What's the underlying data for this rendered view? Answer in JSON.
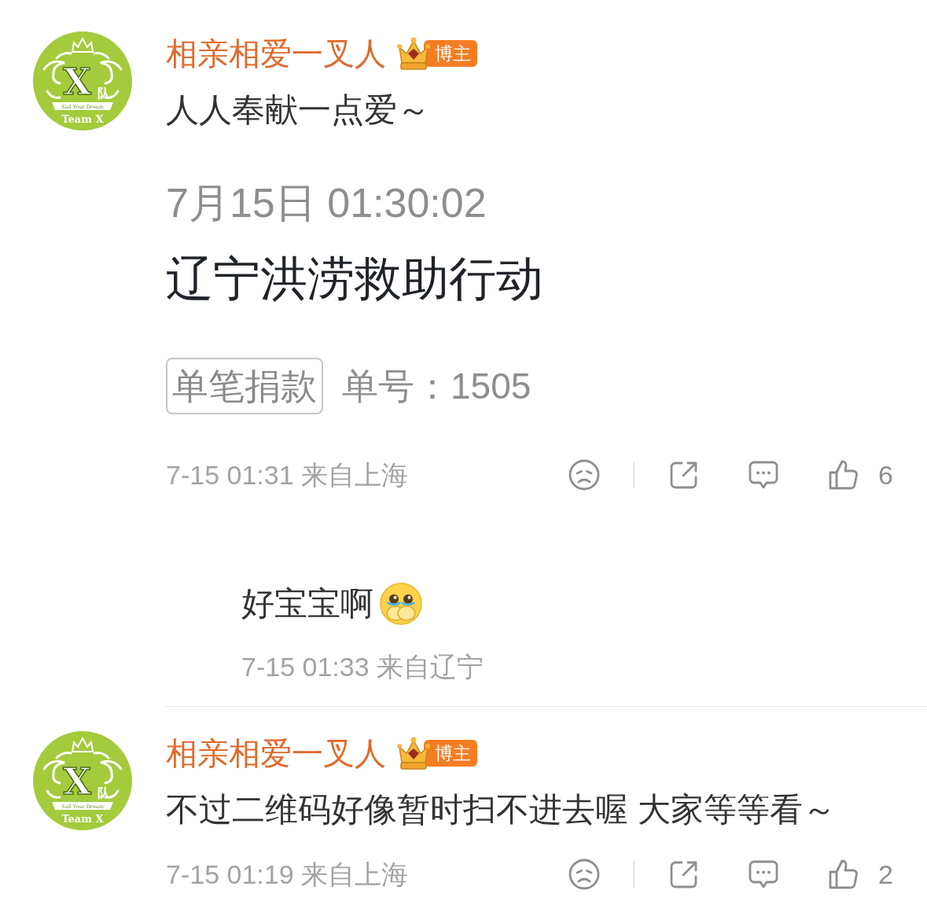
{
  "comments": [
    {
      "avatar": {
        "letter": "X",
        "character": "队",
        "ribbon": "Sail Your Dream",
        "caption": "Team X"
      },
      "username": "相亲相爱一叉人",
      "badge": "博主",
      "text": "人人奉献一点爱～",
      "attachment": {
        "date": "7月15日 01:30:02",
        "title": "辽宁洪涝救助行动",
        "tag": "单笔捐款",
        "order": "单号：1505"
      },
      "meta": "7-15 01:31 来自上海",
      "likes": "6",
      "replies": [
        {
          "text": "好宝宝啊",
          "emoji": true,
          "meta": "7-15 01:33 来自辽宁"
        }
      ]
    },
    {
      "avatar": {
        "letter": "X",
        "character": "队",
        "ribbon": "Sail Your Dream",
        "caption": "Team X"
      },
      "username": "相亲相爱一叉人",
      "badge": "博主",
      "text": "不过二维码好像暂时扫不进去喔 大家等等看～",
      "meta": "7-15 01:19 来自上海",
      "likes": "2"
    }
  ]
}
